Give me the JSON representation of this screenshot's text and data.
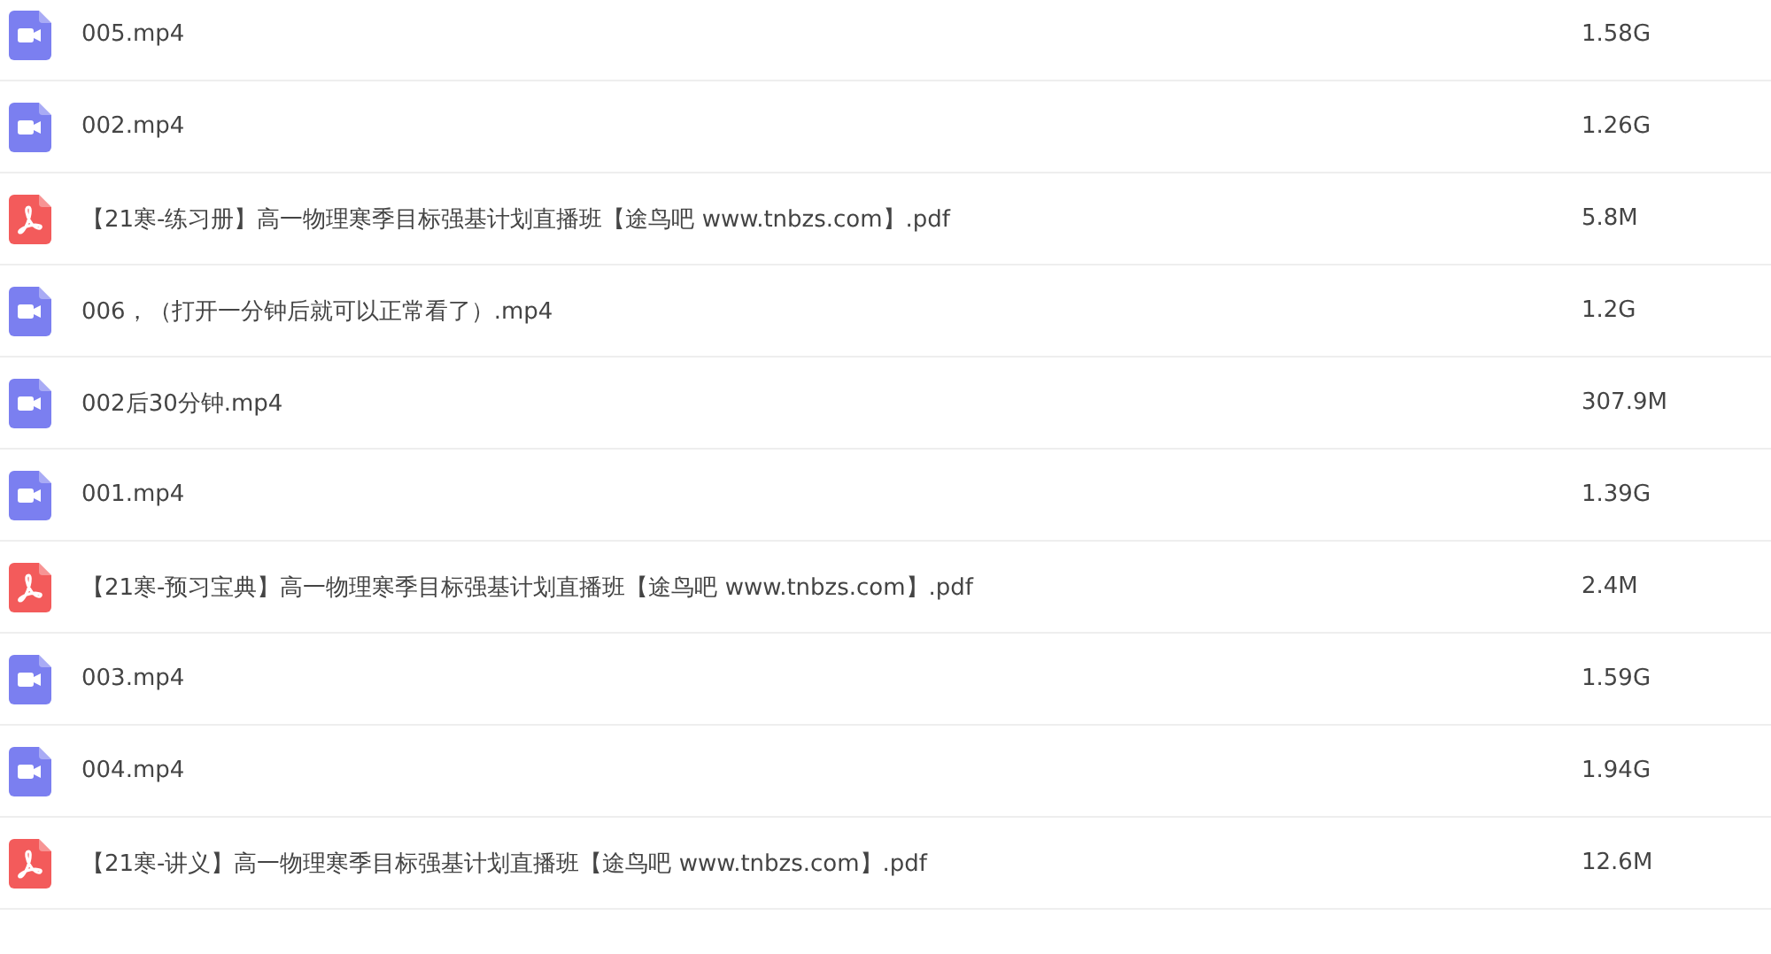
{
  "files": [
    {
      "kind": "video",
      "name": "005.mp4",
      "size": "1.58G"
    },
    {
      "kind": "video",
      "name": "002.mp4",
      "size": "1.26G"
    },
    {
      "kind": "pdf",
      "name": "【21寒-练习册】高一物理寒季目标强基计划直播班【途鸟吧 www.tnbzs.com】.pdf",
      "size": "5.8M"
    },
    {
      "kind": "video",
      "name": "006，（打开一分钟后就可以正常看了）.mp4",
      "size": "1.2G"
    },
    {
      "kind": "video",
      "name": "002后30分钟.mp4",
      "size": "307.9M"
    },
    {
      "kind": "video",
      "name": "001.mp4",
      "size": "1.39G"
    },
    {
      "kind": "pdf",
      "name": "【21寒-预习宝典】高一物理寒季目标强基计划直播班【途鸟吧 www.tnbzs.com】.pdf",
      "size": "2.4M"
    },
    {
      "kind": "video",
      "name": "003.mp4",
      "size": "1.59G"
    },
    {
      "kind": "video",
      "name": "004.mp4",
      "size": "1.94G"
    },
    {
      "kind": "pdf",
      "name": "【21寒-讲义】高一物理寒季目标强基计划直播班【途鸟吧 www.tnbzs.com】.pdf",
      "size": "12.6M"
    }
  ]
}
